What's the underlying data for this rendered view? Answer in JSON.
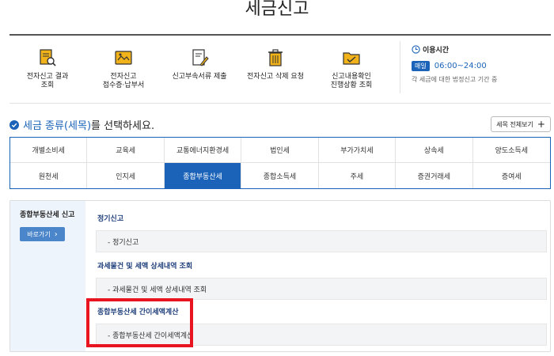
{
  "page_title": "세금신고",
  "services": [
    {
      "label": "전자신고 결과\n조회",
      "icon": "document-search-icon"
    },
    {
      "label": "전자신고\n접수증·납부서",
      "icon": "receipt-icon"
    },
    {
      "label": "신고부속서류 제출",
      "icon": "document-submit-icon"
    },
    {
      "label": "전자신고 삭제 요청",
      "icon": "trash-icon"
    },
    {
      "label": "신고내용확인\n진행상황 조회",
      "icon": "folder-check-icon"
    }
  ],
  "hours": {
    "title": "이용시간",
    "badge": "매일",
    "time": "06:00~24:00",
    "note": "각 세금에 대한 법정신고 기간 중"
  },
  "select_heading": {
    "accent": "세금 종류(세목)",
    "rest": "를 선택하세요."
  },
  "view_all_label": "세목 전체보기",
  "tax_types": [
    "개별소비세",
    "교육세",
    "교통에너지환경세",
    "법인세",
    "부가가치세",
    "상속세",
    "양도소득세",
    "원천세",
    "인지세",
    "종합부동산세",
    "종합소득세",
    "주세",
    "증권거래세",
    "증여세"
  ],
  "active_tax_type": "종합부동산세",
  "detail": {
    "side_title": "종합부동산세 신고",
    "go_label": "바로가기",
    "groups": [
      {
        "title": "정기신고",
        "item": "- 정기신고"
      },
      {
        "title": "과세물건 및 세액 상세내역 조회",
        "item": "- 과세물건 및 세액 상세내역 조회"
      },
      {
        "title": "종합부동산세 간이세액계산",
        "item": "- 종합부동산세 간이세액계산"
      }
    ]
  },
  "colors": {
    "primary": "#1b63b8",
    "button": "#4a86c9",
    "highlight": "#e8141f",
    "side_bg": "#eef4fb",
    "icon_yellow": "#f2b31a"
  }
}
